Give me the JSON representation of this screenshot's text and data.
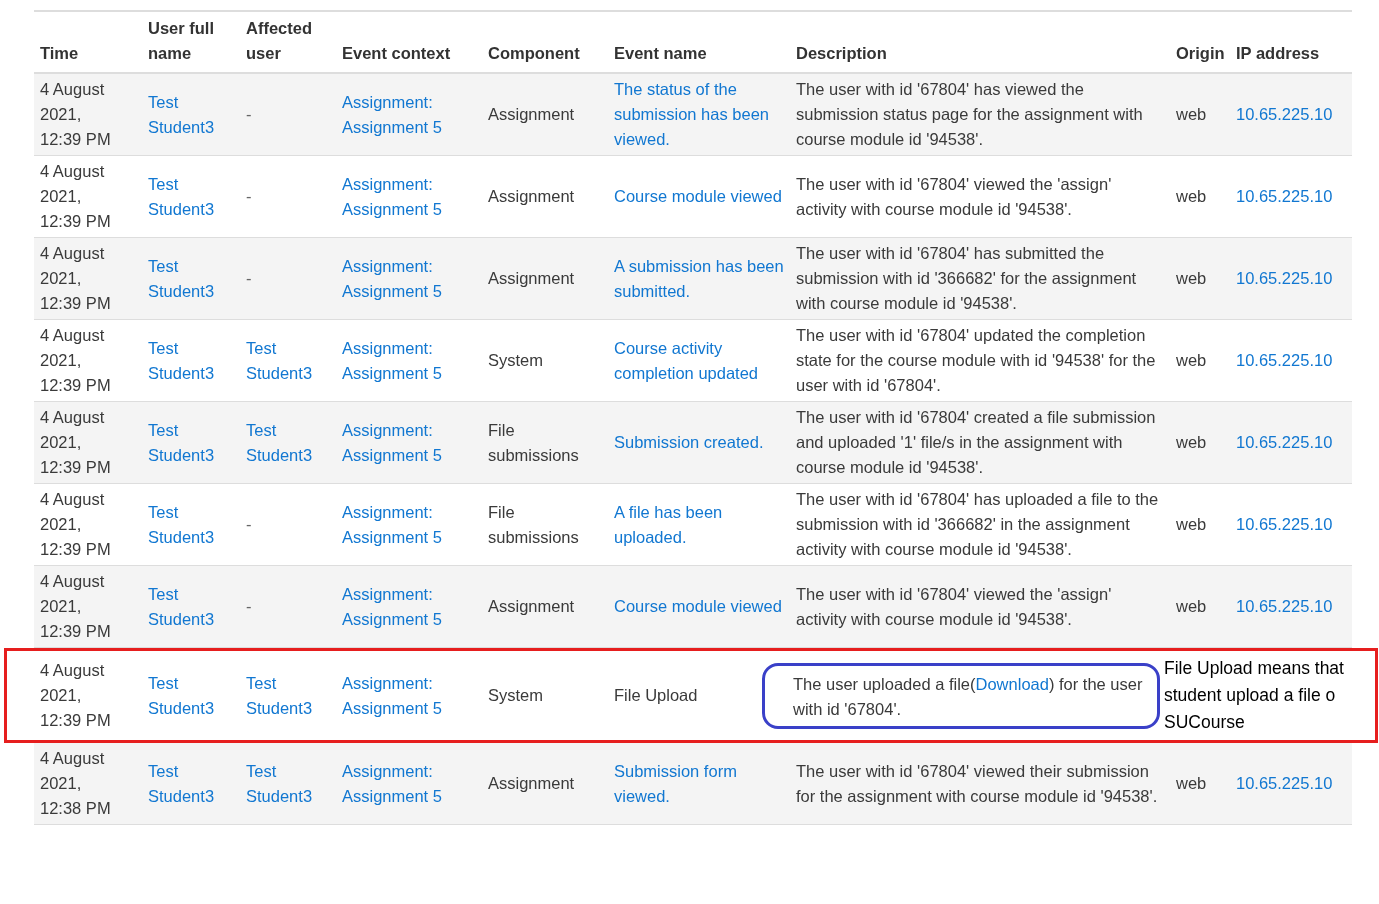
{
  "table": {
    "columns": [
      "Time",
      "User full name",
      "Affected user",
      "Event context",
      "Component",
      "Event name",
      "Description",
      "Origin",
      "IP address"
    ],
    "rows": [
      {
        "kind": "normal",
        "time": "4 August 2021, 12:39 PM",
        "user": "Test Student3",
        "affected": "-",
        "context": "Assignment: Assignment 5",
        "component": "Assignment",
        "event": "The status of the submission has been viewed.",
        "event_link": true,
        "description": "The user with id '67804' has viewed the submission status page for the assignment with course module id '94538'.",
        "origin": "web",
        "ip": "10.65.225.10"
      },
      {
        "kind": "normal",
        "time": "4 August 2021, 12:39 PM",
        "user": "Test Student3",
        "affected": "-",
        "context": "Assignment: Assignment 5",
        "component": "Assignment",
        "event": "Course module viewed",
        "event_link": true,
        "description": "The user with id '67804' viewed the 'assign' activity with course module id '94538'.",
        "origin": "web",
        "ip": "10.65.225.10"
      },
      {
        "kind": "normal",
        "time": "4 August 2021, 12:39 PM",
        "user": "Test Student3",
        "affected": "-",
        "context": "Assignment: Assignment 5",
        "component": "Assignment",
        "event": "A submission has been submitted.",
        "event_link": true,
        "description": "The user with id '67804' has submitted the submission with id '366682' for the assignment with course module id '94538'.",
        "origin": "web",
        "ip": "10.65.225.10"
      },
      {
        "kind": "normal",
        "time": "4 August 2021, 12:39 PM",
        "user": "Test Student3",
        "affected": "Test Student3",
        "context": "Assignment: Assignment 5",
        "component": "System",
        "event": "Course activity completion updated",
        "event_link": true,
        "description": "The user with id '67804' updated the completion state for the course module with id '94538' for the user with id '67804'.",
        "origin": "web",
        "ip": "10.65.225.10"
      },
      {
        "kind": "normal",
        "time": "4 August 2021, 12:39 PM",
        "user": "Test Student3",
        "affected": "Test Student3",
        "context": "Assignment: Assignment 5",
        "component": "File submissions",
        "event": "Submission created.",
        "event_link": true,
        "description": "The user with id '67804' created a file submission and uploaded '1' file/s in the assignment with course module id '94538'.",
        "origin": "web",
        "ip": "10.65.225.10"
      },
      {
        "kind": "normal",
        "time": "4 August 2021, 12:39 PM",
        "user": "Test Student3",
        "affected": "-",
        "context": "Assignment: Assignment 5",
        "component": "File submissions",
        "event": "A file has been uploaded.",
        "event_link": true,
        "description": "The user with id '67804' has uploaded a file to the submission with id '366682' in the assignment activity with course module id '94538'.",
        "origin": "web",
        "ip": "10.65.225.10"
      },
      {
        "kind": "normal",
        "time": "4 August 2021, 12:39 PM",
        "user": "Test Student3",
        "affected": "-",
        "context": "Assignment: Assignment 5",
        "component": "Assignment",
        "event": "Course module viewed",
        "event_link": true,
        "description": "The user with id '67804' viewed the 'assign' activity with course module id '94538'.",
        "origin": "web",
        "ip": "10.65.225.10"
      },
      {
        "kind": "annotated",
        "time": "4 August 2021, 12:39 PM",
        "user": "Test Student3",
        "affected": "Test Student3",
        "context": "Assignment: Assignment 5",
        "component": "System",
        "event": "File Upload",
        "event_link": false,
        "description_before": "The user uploaded a file(",
        "description_link": "Download",
        "description_after": ") for the user with id '67804'.",
        "annotation_lines": [
          "File Upload means that",
          "student upload a file o",
          "SUCourse"
        ]
      },
      {
        "kind": "normal",
        "time": "4 August 2021, 12:38 PM",
        "user": "Test Student3",
        "affected": "Test Student3",
        "context": "Assignment: Assignment 5",
        "component": "Assignment",
        "event": "Submission form viewed.",
        "event_link": true,
        "description": "The user with id '67804' viewed their submission for the assignment with course module id '94538'.",
        "origin": "web",
        "ip": "10.65.225.10"
      }
    ]
  }
}
